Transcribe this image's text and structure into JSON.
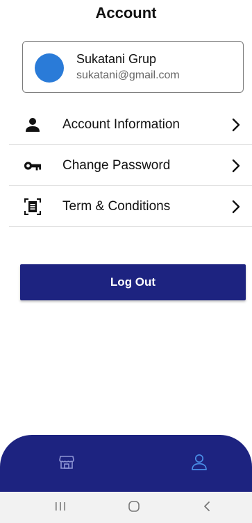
{
  "header": {
    "title": "Account"
  },
  "profile": {
    "name": "Sukatani Grup",
    "email": "sukatani@gmail.com",
    "avatar_color": "#2a7bd8"
  },
  "menu": {
    "items": [
      {
        "label": "Account Information",
        "icon": "person-icon"
      },
      {
        "label": "Change Password",
        "icon": "key-icon"
      },
      {
        "label": "Term & Conditions",
        "icon": "document-icon"
      }
    ]
  },
  "actions": {
    "logout_label": "Log Out"
  },
  "colors": {
    "primary": "#1d2380",
    "active_nav_icon": "#4a8fe8",
    "inactive_nav_icon": "#8f96d6"
  },
  "bottom_nav": {
    "items": [
      {
        "icon": "store-icon",
        "active": false
      },
      {
        "icon": "person-outline-icon",
        "active": true
      }
    ]
  },
  "system_nav": {
    "items": [
      {
        "icon": "recents-icon"
      },
      {
        "icon": "home-icon"
      },
      {
        "icon": "back-icon"
      }
    ]
  }
}
